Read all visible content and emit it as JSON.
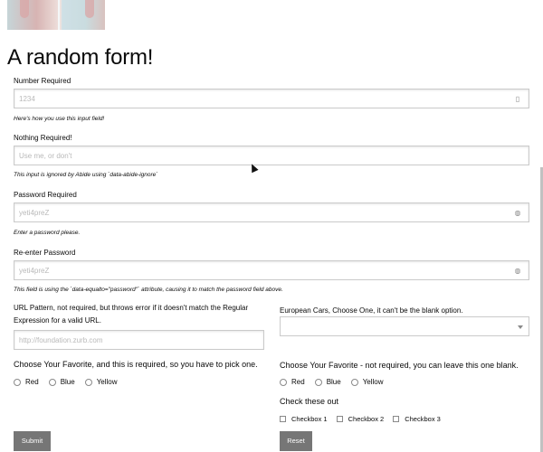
{
  "page": {
    "title": "A random form!"
  },
  "fields": {
    "number": {
      "label": "Number Required",
      "placeholder": "1234",
      "help": "Here's how you use this input field!"
    },
    "nothing": {
      "label": "Nothing Required!",
      "placeholder": "Use me, or don't",
      "help": "This input is ignored by Abide using `data-abide-ignore`"
    },
    "password": {
      "label": "Password Required",
      "placeholder": "yeti4preZ",
      "help": "Enter a password please."
    },
    "reenter": {
      "label": "Re-enter Password",
      "placeholder": "yeti4preZ",
      "help": "This field is using the `data-equalto=\"password\"` attribute, causing it to match the password field above."
    },
    "url": {
      "label": "URL Pattern, not required, but throws error if it doesn't match the Regular Expression for a valid URL.",
      "placeholder": "http://foundation.zurb.com"
    },
    "cars": {
      "label": "European Cars, Choose One, it can't be the blank option.",
      "selected": ""
    }
  },
  "radios_left": {
    "legend": "Choose Your Favorite, and this is required, so you have to pick one.",
    "options": [
      "Red",
      "Blue",
      "Yellow"
    ]
  },
  "radios_right": {
    "legend": "Choose Your Favorite - not required, you can leave this one blank.",
    "options": [
      "Red",
      "Blue",
      "Yellow"
    ]
  },
  "checkboxes": {
    "legend": "Check these out",
    "options": [
      "Checkbox 1",
      "Checkbox 2",
      "Checkbox 3"
    ]
  },
  "buttons": {
    "submit": "Submit",
    "reset": "Reset"
  },
  "colors": {
    "button": "#767676",
    "border": "#cacaca",
    "placeholder": "#b9b9b9"
  }
}
